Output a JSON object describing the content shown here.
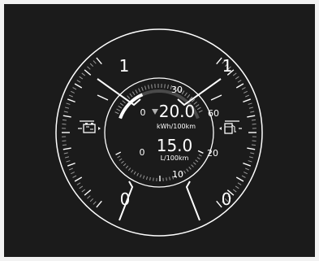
{
  "cluster": {
    "left_gauge": {
      "icon": "battery-charge-icon",
      "scale_labels": {
        "full": "1",
        "empty": "0"
      },
      "level": 0.5
    },
    "right_gauge": {
      "icon": "fuel-pump-icon",
      "scale_labels": {
        "full": "1",
        "empty": "0"
      },
      "level": 0.5
    },
    "electric_consumption": {
      "value": "20.0",
      "unit": "kWh/100km",
      "scale_min": "0",
      "scale_mid": "30",
      "scale_max": "60",
      "fill_fraction": 0.33
    },
    "fuel_consumption": {
      "value": "15.0",
      "unit": "L/100km",
      "scale_min": "0",
      "scale_mid": "10",
      "scale_max": "20"
    },
    "colors": {
      "background": "#1b1b1b",
      "foreground": "#ffffff",
      "dim_tick": "#9a9a9a",
      "indicator": "#b0b0b0"
    }
  }
}
